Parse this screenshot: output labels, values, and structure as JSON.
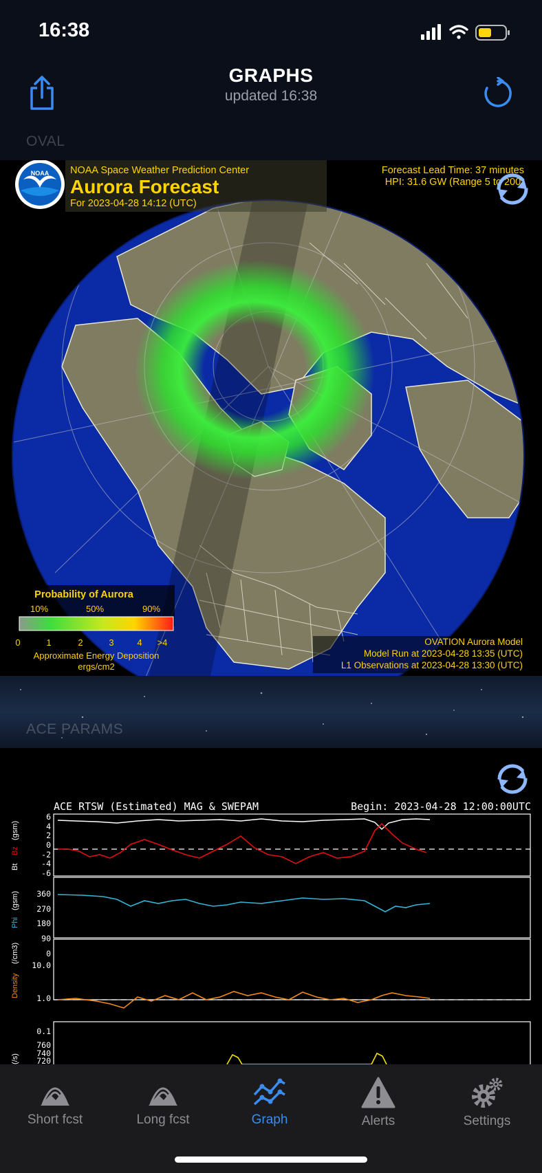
{
  "status_bar": {
    "time": "16:38"
  },
  "nav": {
    "title": "GRAPHS",
    "subtitle": "updated  16:38"
  },
  "sections": {
    "oval": "OVAL",
    "ace": "ACE PARAMS"
  },
  "aurora_map": {
    "header": "NOAA Space Weather Prediction Center",
    "title": "Aurora Forecast",
    "for_time": "For 2023-04-28 14:12 (UTC)",
    "lead_time": "Forecast Lead Time:  37 minutes",
    "hpi": "HPI:  31.6 GW (Range 5 to 200)",
    "noaa_logo": "NOAA",
    "legend": {
      "title": "Probability of Aurora",
      "pct_labels": [
        "10%",
        "50%",
        "90%"
      ],
      "scale_labels": [
        "0",
        "1",
        "2",
        "3",
        "4",
        ">4"
      ],
      "energy_label": "Approximate Energy Deposition",
      "units": "ergs/cm2"
    },
    "model": {
      "name": "OVATION Aurora Model",
      "run": "Model Run at 2023-04-28 13:35 (UTC)",
      "obs": "L1 Observations at 2023-04-28 13:30 (UTC)"
    }
  },
  "ace_graph": {
    "title": "ACE RTSW (Estimated) MAG & SWEPAM",
    "begin": "Begin: 2023-04-28 12:00:00UTC",
    "panels": [
      {
        "label_a": "Bt",
        "label_b": "Bz",
        "unit": "(gsm)",
        "ticks": [
          "6",
          "4",
          "2",
          "0",
          "-2",
          "-4",
          "-6"
        ]
      },
      {
        "label": "Phi",
        "unit": "(gsm)",
        "ticks": [
          "360",
          "270",
          "180",
          "90",
          "0"
        ]
      },
      {
        "label": "Density",
        "unit": "(/cm3)",
        "ticks": [
          "10.0",
          "1.0",
          "0.1"
        ]
      },
      {
        "label": "(/s)",
        "ticks": [
          "760",
          "740",
          "720"
        ]
      }
    ],
    "colors": {
      "bt": "#ffffff",
      "bz": "#e01010",
      "phi": "#2fb8d8",
      "density": "#f08a18",
      "speed": "#f2e400"
    }
  },
  "tabs": [
    {
      "label": "Short fcst",
      "icon": "aurora-short-icon",
      "active": false
    },
    {
      "label": "Long fcst",
      "icon": "aurora-long-icon",
      "active": false
    },
    {
      "label": "Graph",
      "icon": "graph-icon",
      "active": true
    },
    {
      "label": "Alerts",
      "icon": "alert-icon",
      "active": false
    },
    {
      "label": "Settings",
      "icon": "gear-icon",
      "active": false
    }
  ],
  "colors": {
    "accent": "#3b8cf0",
    "battery": "#ffd60a",
    "aurora": "#2ee02e"
  }
}
